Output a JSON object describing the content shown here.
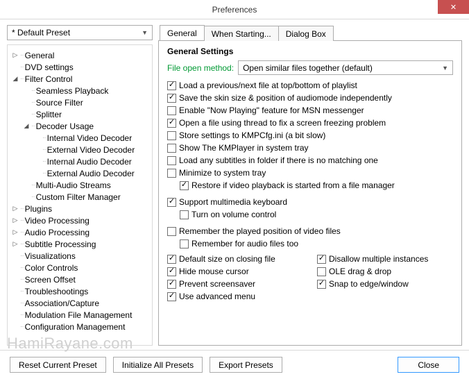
{
  "window": {
    "title": "Preferences",
    "close_glyph": "✕"
  },
  "preset": {
    "value": "* Default Preset"
  },
  "tree": [
    {
      "label": "General",
      "depth": 0,
      "twisty": "closed"
    },
    {
      "label": "DVD settings",
      "depth": 0,
      "twisty": "none"
    },
    {
      "label": "Filter Control",
      "depth": 0,
      "twisty": "open"
    },
    {
      "label": "Seamless Playback",
      "depth": 1,
      "twisty": "none"
    },
    {
      "label": "Source Filter",
      "depth": 1,
      "twisty": "none"
    },
    {
      "label": "Splitter",
      "depth": 1,
      "twisty": "none"
    },
    {
      "label": "Decoder Usage",
      "depth": 1,
      "twisty": "open"
    },
    {
      "label": "Internal Video Decoder",
      "depth": 2,
      "twisty": "none"
    },
    {
      "label": "External Video Decoder",
      "depth": 2,
      "twisty": "none"
    },
    {
      "label": "Internal Audio Decoder",
      "depth": 2,
      "twisty": "none"
    },
    {
      "label": "External Audio Decoder",
      "depth": 2,
      "twisty": "none"
    },
    {
      "label": "Multi-Audio Streams",
      "depth": 1,
      "twisty": "none"
    },
    {
      "label": "Custom Filter Manager",
      "depth": 1,
      "twisty": "none"
    },
    {
      "label": "Plugins",
      "depth": 0,
      "twisty": "closed"
    },
    {
      "label": "Video Processing",
      "depth": 0,
      "twisty": "closed"
    },
    {
      "label": "Audio Processing",
      "depth": 0,
      "twisty": "closed"
    },
    {
      "label": "Subtitle Processing",
      "depth": 0,
      "twisty": "closed"
    },
    {
      "label": "Visualizations",
      "depth": 0,
      "twisty": "none"
    },
    {
      "label": "Color Controls",
      "depth": 0,
      "twisty": "none"
    },
    {
      "label": "Screen Offset",
      "depth": 0,
      "twisty": "none"
    },
    {
      "label": "Troubleshootings",
      "depth": 0,
      "twisty": "none"
    },
    {
      "label": "Association/Capture",
      "depth": 0,
      "twisty": "none"
    },
    {
      "label": "Modulation File Management",
      "depth": 0,
      "twisty": "none"
    },
    {
      "label": "Configuration Management",
      "depth": 0,
      "twisty": "none"
    }
  ],
  "tabs": {
    "general": "General",
    "when_starting": "When Starting...",
    "dialog_box": "Dialog Box"
  },
  "panel": {
    "title": "General Settings",
    "file_open_label": "File open method:",
    "file_open_value": "Open similar files together (default)",
    "checks": [
      {
        "label": "Load a previous/next file at top/bottom of playlist",
        "checked": true
      },
      {
        "label": "Save the skin size & position of audiomode independently",
        "checked": true
      },
      {
        "label": "Enable \"Now Playing\" feature for MSN messenger",
        "checked": false
      },
      {
        "label": "Open a file using thread to fix a screen freezing problem",
        "checked": true
      },
      {
        "label": "Store settings to KMPCfg.ini (a bit slow)",
        "checked": false
      },
      {
        "label": "Show The KMPlayer in system tray",
        "checked": false
      },
      {
        "label": "Load any subtitles in folder if there is no matching one",
        "checked": false
      },
      {
        "label": "Minimize to system tray",
        "checked": false
      },
      {
        "label": "Restore if video playback is started from a file manager",
        "checked": true,
        "sub": true
      }
    ],
    "checks2": [
      {
        "label": "Support multimedia keyboard",
        "checked": true
      },
      {
        "label": "Turn on volume control",
        "checked": false,
        "sub": true
      }
    ],
    "checks3": [
      {
        "label": "Remember the played position of video files",
        "checked": false
      },
      {
        "label": "Remember for audio files too",
        "checked": false,
        "sub": true
      }
    ],
    "col_left": [
      {
        "label": "Default size on closing file",
        "checked": true
      },
      {
        "label": "Hide mouse cursor",
        "checked": true
      },
      {
        "label": "Prevent screensaver",
        "checked": true
      },
      {
        "label": "Use advanced menu",
        "checked": true
      }
    ],
    "col_right": [
      {
        "label": "Disallow multiple instances",
        "checked": true
      },
      {
        "label": "OLE drag & drop",
        "checked": false
      },
      {
        "label": "Snap to edge/window",
        "checked": true
      }
    ]
  },
  "footer": {
    "reset": "Reset Current Preset",
    "init": "Initialize All Presets",
    "export": "Export Presets",
    "close": "Close"
  },
  "watermark": "HamiRayane.com"
}
